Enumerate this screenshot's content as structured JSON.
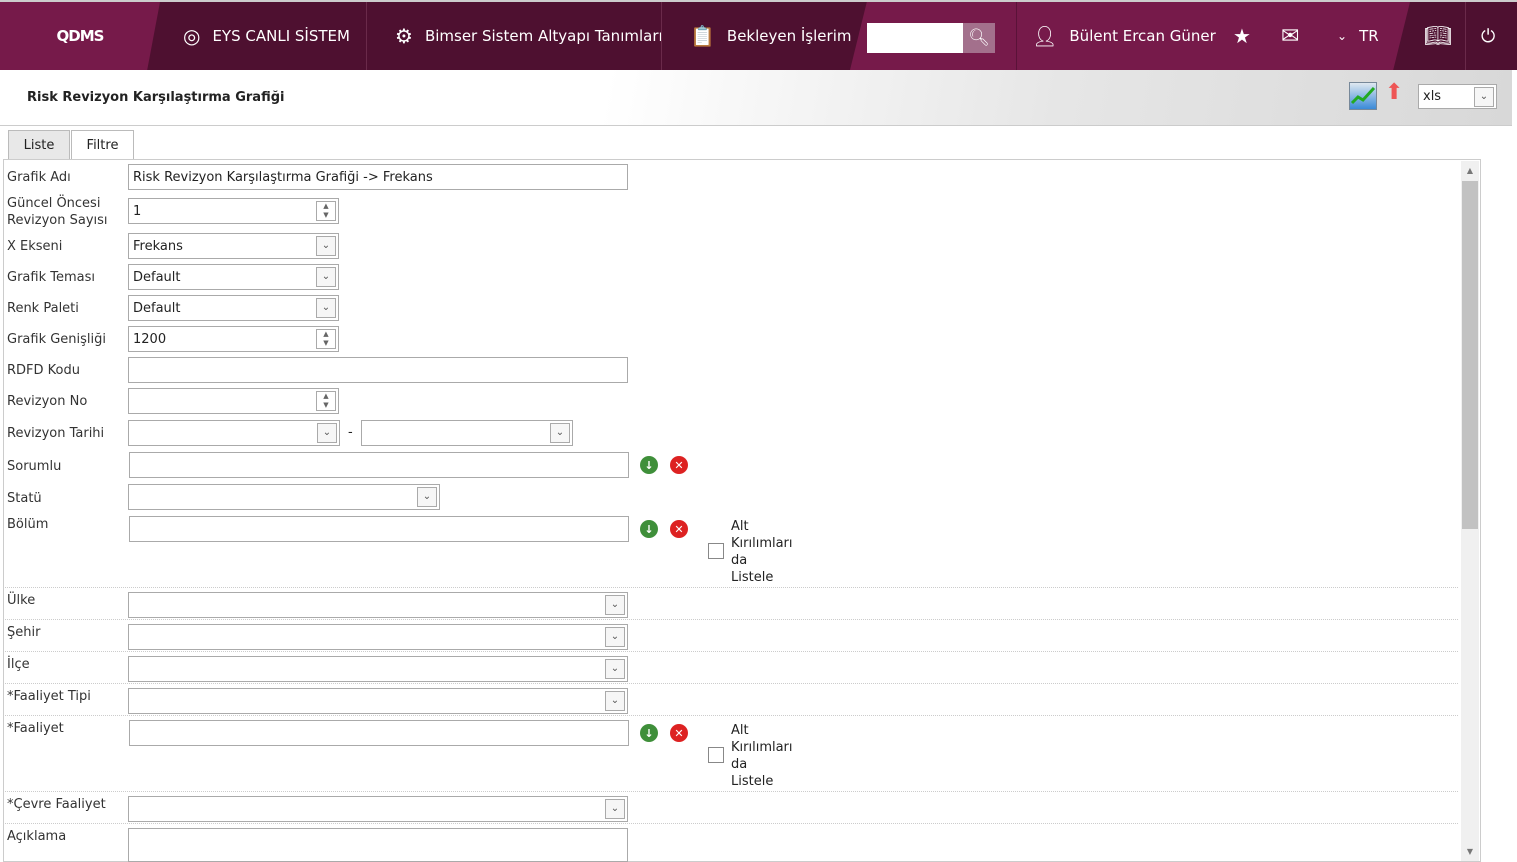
{
  "header": {
    "logo": "QDMS",
    "nav": [
      {
        "label": "EYS CANLI SİSTEM",
        "icon": "qdms-icon"
      },
      {
        "label": "Bimser Sistem Altyapı Tanımları",
        "icon": "gear-icon"
      },
      {
        "label": "Bekleyen İşlerim",
        "icon": "clipboard-icon"
      }
    ],
    "search_placeholder": "",
    "user": "Bülent Ercan Güner",
    "lang": "TR"
  },
  "page": {
    "title": "Risk Revizyon Karşılaştırma Grafiği",
    "export_format": "xls"
  },
  "tabs": [
    "Liste",
    "Filtre"
  ],
  "form": {
    "grafik_adi": {
      "label": "Grafik Adı",
      "value": "Risk Revizyon Karşılaştırma Grafiği -> Frekans"
    },
    "guncel": {
      "label1": "Güncel Öncesi",
      "label2": "Revizyon Sayısı",
      "value": "1"
    },
    "x_ekseni": {
      "label": "X Ekseni",
      "value": "Frekans"
    },
    "tema": {
      "label": "Grafik Teması",
      "value": "Default"
    },
    "palet": {
      "label": "Renk Paleti",
      "value": "Default"
    },
    "genislik": {
      "label": "Grafik Genişliği",
      "value": "1200"
    },
    "rdfd": {
      "label": "RDFD Kodu",
      "value": ""
    },
    "rev_no": {
      "label": "Revizyon No",
      "value": ""
    },
    "rev_tarihi": {
      "label": "Revizyon Tarihi",
      "sep": "-"
    },
    "sorumlu": {
      "label": "Sorumlu"
    },
    "statu": {
      "label": "Statü"
    },
    "bolum": {
      "label": "Bölüm"
    },
    "alt": [
      "Alt",
      "Kırılımları",
      "da",
      "Listele"
    ],
    "ulke": {
      "label": "Ülke"
    },
    "sehir": {
      "label": "Şehir"
    },
    "ilce": {
      "label": "İlçe"
    },
    "faaliyet_tipi": {
      "label": "*Faaliyet Tipi"
    },
    "faaliyet": {
      "label": "*Faaliyet"
    },
    "cevre": {
      "label": "*Çevre Faaliyet"
    },
    "aciklama": {
      "label": "Açıklama"
    }
  }
}
